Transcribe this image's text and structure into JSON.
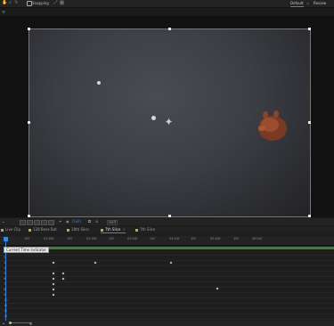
{
  "toolbar": {
    "snapping_label": "Snapping",
    "workspace_default": "Default",
    "workspace_review": "Review"
  },
  "viewer": {
    "zoom_label": "(Full)",
    "resolution_label": "Half"
  },
  "comp_tabs": [
    {
      "label": "Live Clip",
      "color": "#a0a0a0"
    },
    {
      "label": "128 Bees Bat",
      "color": "#c7a94d"
    },
    {
      "label": "18th Slice",
      "color": "#c7a94d"
    },
    {
      "label": "7th Slice",
      "color": "#c7a94d"
    },
    {
      "label": "7th Slice",
      "color": "#c7a94d"
    }
  ],
  "timeline": {
    "tooltip": "Current Time Indicator",
    "ruler_labels": [
      "0f",
      "10f",
      "01:00f",
      "10f",
      "02:00f",
      "10f",
      "03:00f",
      "10f",
      "04:00f",
      "10f",
      "05:00f",
      "10f",
      "06:00f"
    ],
    "row_numbers": [
      "1",
      "2",
      "3",
      "4",
      "5",
      "6",
      "7",
      "8",
      "9",
      "10",
      "11",
      "12",
      "13",
      "14",
      "15"
    ]
  },
  "colors": {
    "playhead": "#3d86d6",
    "work_area": "#3f7f3a",
    "accent": "#3d86d6"
  }
}
